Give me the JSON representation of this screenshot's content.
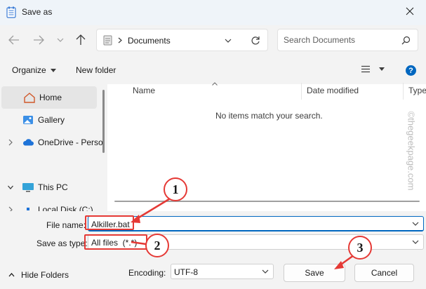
{
  "window": {
    "title": "Save as"
  },
  "address": {
    "location": "Documents"
  },
  "search": {
    "placeholder": "Search Documents"
  },
  "toolbar": {
    "organize_label": "Organize",
    "new_folder_label": "New folder"
  },
  "sidebar": {
    "items": [
      {
        "label": "Home"
      },
      {
        "label": "Gallery"
      },
      {
        "label": "OneDrive - Perso"
      },
      {
        "label": "This PC"
      },
      {
        "label": "Local Disk (C:)"
      }
    ]
  },
  "file_list": {
    "columns": [
      "Name",
      "Date modified",
      "Type"
    ],
    "empty_message": "No items match your search."
  },
  "form": {
    "file_name_label": "File name:",
    "file_name_value": "Alkiller.bat",
    "save_type_label": "Save as type:",
    "save_type_value": "All files  (*.*)",
    "encoding_label": "Encoding:",
    "encoding_value": "UTF-8",
    "save_label": "Save",
    "cancel_label": "Cancel",
    "hide_folders_label": "Hide Folders"
  },
  "annotations": {
    "step1": "1",
    "step2": "2",
    "step3": "3",
    "color": "#e53935"
  },
  "watermark": {
    "text": "©thegeekpage.com"
  },
  "colors": {
    "accent": "#0067c0",
    "help": "#0067c0"
  }
}
